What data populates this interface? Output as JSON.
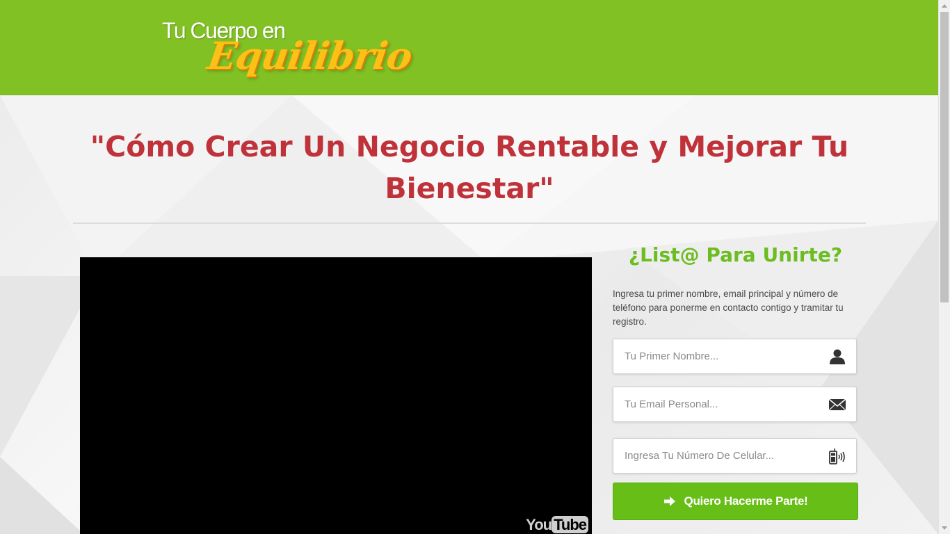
{
  "header": {
    "logo_line1": "Tu Cuerpo en",
    "logo_line2": "Equilibrio",
    "background_color": "#81c123"
  },
  "main": {
    "headline": "\"Cómo Crear Un Negocio Rentable y Mejorar Tu Bienestar\"",
    "headline_color": "#c0323a"
  },
  "video": {
    "provider_label_1": "You",
    "provider_label_2": "Tube"
  },
  "form": {
    "title": "¿List@ Para Unirte?",
    "title_color": "#6cbd21",
    "description": "Ingresa tu primer nombre, email principal y número de teléfono para ponerme en contacto contigo y tramitar tu registro.",
    "fields": [
      {
        "placeholder": "Tu Primer Nombre...",
        "icon": "user-icon"
      },
      {
        "placeholder": "Tu Email Personal...",
        "icon": "envelope-icon"
      },
      {
        "placeholder": "Ingresa Tu Número De Celular...",
        "icon": "mobile-phone-icon"
      }
    ],
    "submit_label": "Quiero Hacerme Parte!",
    "submit_icon": "arrow-right-icon",
    "submit_color": "#67be17"
  }
}
